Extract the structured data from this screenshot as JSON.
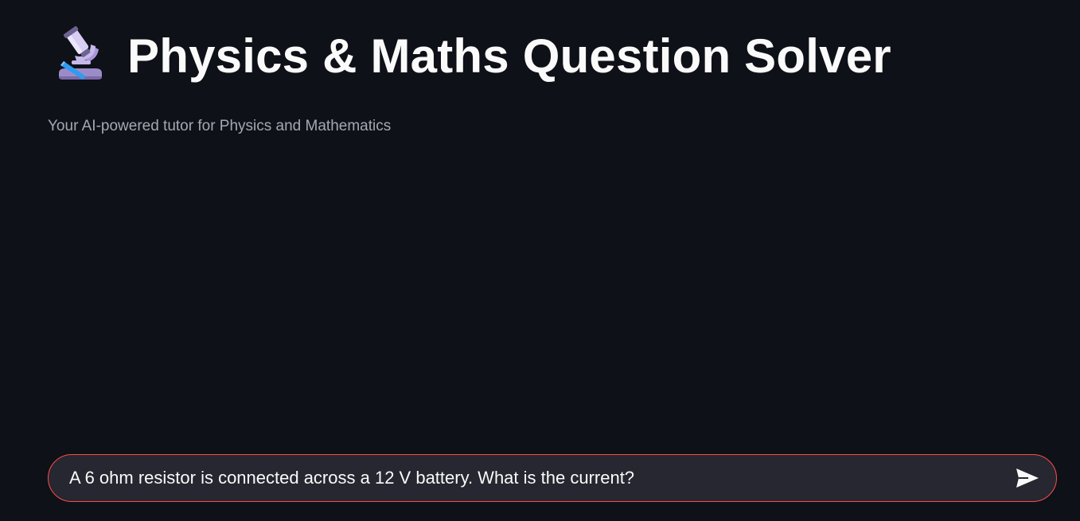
{
  "header": {
    "icon": "microscope-icon",
    "title": "Physics & Maths Question Solver",
    "subtitle": "Your AI-powered tutor for Physics and Mathematics"
  },
  "chat": {
    "input_value": "A 6 ohm resistor is connected across a 12 V battery. What is the current?",
    "send_icon": "send-icon"
  },
  "colors": {
    "background": "#0e1117",
    "input_background": "#262730",
    "input_border": "#ff4b4b",
    "title_text": "#fafafa",
    "subtitle_text": "#a3a8b4"
  }
}
